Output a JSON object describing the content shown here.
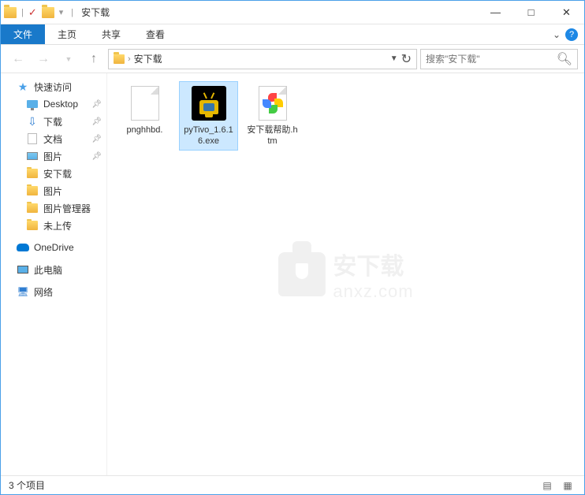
{
  "window": {
    "title": "安下载"
  },
  "ribbon": {
    "tabs": {
      "file": "文件",
      "home": "主页",
      "share": "共享",
      "view": "查看"
    }
  },
  "nav": {
    "current_folder": "安下载",
    "search_placeholder": "搜索\"安下载\""
  },
  "sidebar": {
    "quick_access": "快速访问",
    "items": [
      {
        "label": "Desktop",
        "pinned": true
      },
      {
        "label": "下载",
        "pinned": true
      },
      {
        "label": "文档",
        "pinned": true
      },
      {
        "label": "图片",
        "pinned": true
      },
      {
        "label": "安下载",
        "pinned": false
      },
      {
        "label": "图片",
        "pinned": false
      },
      {
        "label": "图片管理器",
        "pinned": false
      },
      {
        "label": "未上传",
        "pinned": false
      }
    ],
    "onedrive": "OneDrive",
    "this_pc": "此电脑",
    "network": "网络"
  },
  "files": [
    {
      "name": "pnghhbd.",
      "type": "blank",
      "selected": false
    },
    {
      "name": "pyTivo_1.6.16.exe",
      "type": "exe",
      "selected": true
    },
    {
      "name": "安下载帮助.htm",
      "type": "htm",
      "selected": false
    }
  ],
  "statusbar": {
    "count": "3 个项目"
  },
  "watermark": {
    "line1": "安下载",
    "line2": "anxz.com"
  }
}
